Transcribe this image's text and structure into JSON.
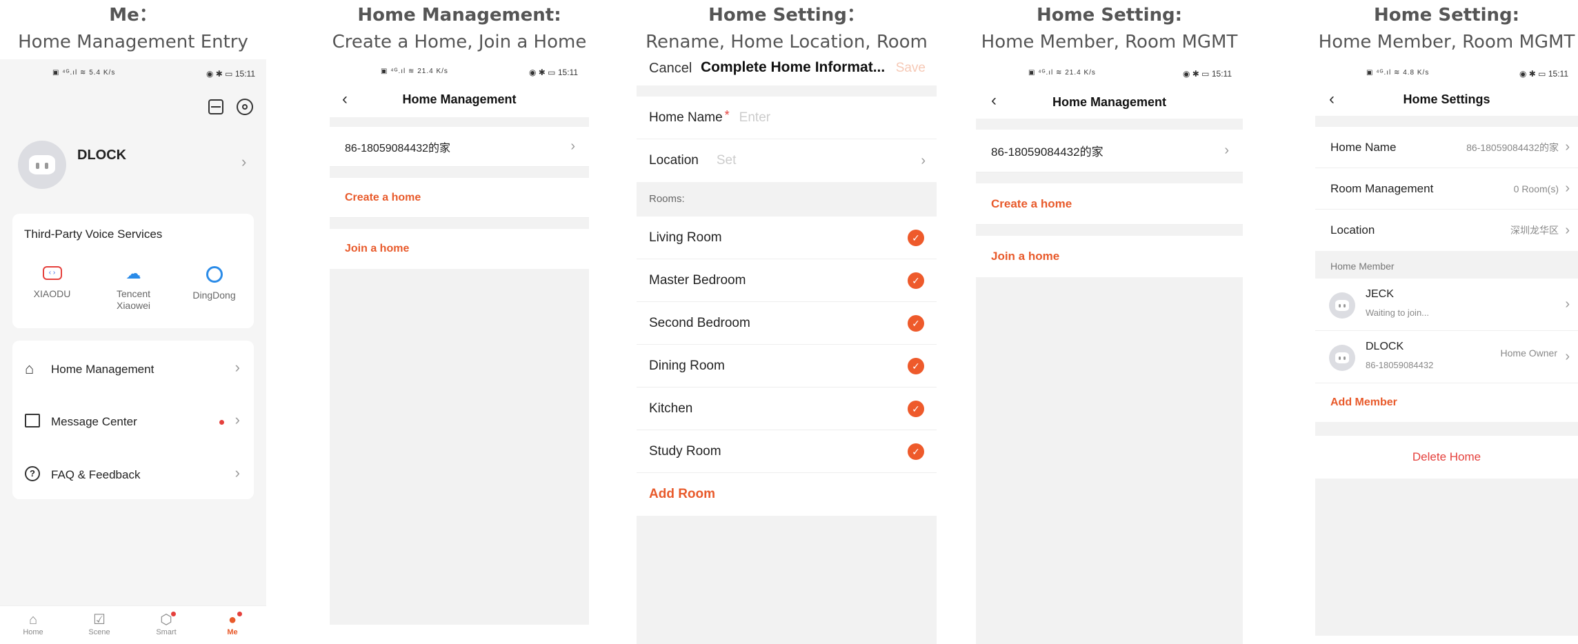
{
  "captions": [
    {
      "l1": "Me：",
      "l2": "Home Management Entry"
    },
    {
      "l1": "Home Management:",
      "l2": "Create a Home, Join a Home"
    },
    {
      "l1": "Home Setting：",
      "l2": "Rename, Home Location, Room MGMT"
    },
    {
      "l1": "Home Setting:",
      "l2": "Home Member, Room MGMT"
    },
    {
      "l1": "Home Setting:",
      "l2": "Home Member, Room MGMT"
    }
  ],
  "status": {
    "time": "15:11",
    "net_p1": "5.4 K/s",
    "net_p2": "21.4 K/s",
    "net_p4": "21.4 K/s",
    "net_p5": "4.8 K/s"
  },
  "p1": {
    "user_name": "DLOCK",
    "voice_title": "Third-Party Voice Services",
    "voice_items": [
      "XIAODU",
      "Tencent Xiaowei",
      "DingDong"
    ],
    "menu": [
      "Home Management",
      "Message Center",
      "FAQ & Feedback"
    ],
    "tabs": [
      "Home",
      "Scene",
      "Smart",
      "Me"
    ]
  },
  "p2": {
    "title": "Home Management",
    "home": "86-18059084432的家",
    "create": "Create a home",
    "join": "Join a home"
  },
  "p3": {
    "cancel": "Cancel",
    "title": "Complete Home Informat...",
    "save": "Save",
    "home_name_label": "Home Name",
    "required": "*",
    "home_name_placeholder": "Enter",
    "location_label": "Location",
    "location_placeholder": "Set",
    "rooms_header": "Rooms:",
    "rooms": [
      "Living Room",
      "Master Bedroom",
      "Second Bedroom",
      "Dining Room",
      "Kitchen",
      "Study Room"
    ],
    "add_room": "Add Room"
  },
  "p4": {
    "title": "Home Management",
    "home": "86-18059084432的家",
    "create": "Create a home",
    "join": "Join a home"
  },
  "p5": {
    "title": "Home Settings",
    "home_name_label": "Home Name",
    "home_name_value": "86-18059084432的家",
    "room_label": "Room Management",
    "room_value": "0 Room(s)",
    "location_label": "Location",
    "location_value": "深圳龙华区",
    "member_header": "Home Member",
    "members": [
      {
        "name": "JECK",
        "sub": "Waiting to join...",
        "role": ""
      },
      {
        "name": "DLOCK",
        "sub": "86-18059084432",
        "role": "Home Owner"
      }
    ],
    "add_member": "Add Member",
    "delete_home": "Delete Home"
  },
  "colors": {
    "accent": "#e85a2b",
    "background_gray": "#f2f2f2"
  }
}
